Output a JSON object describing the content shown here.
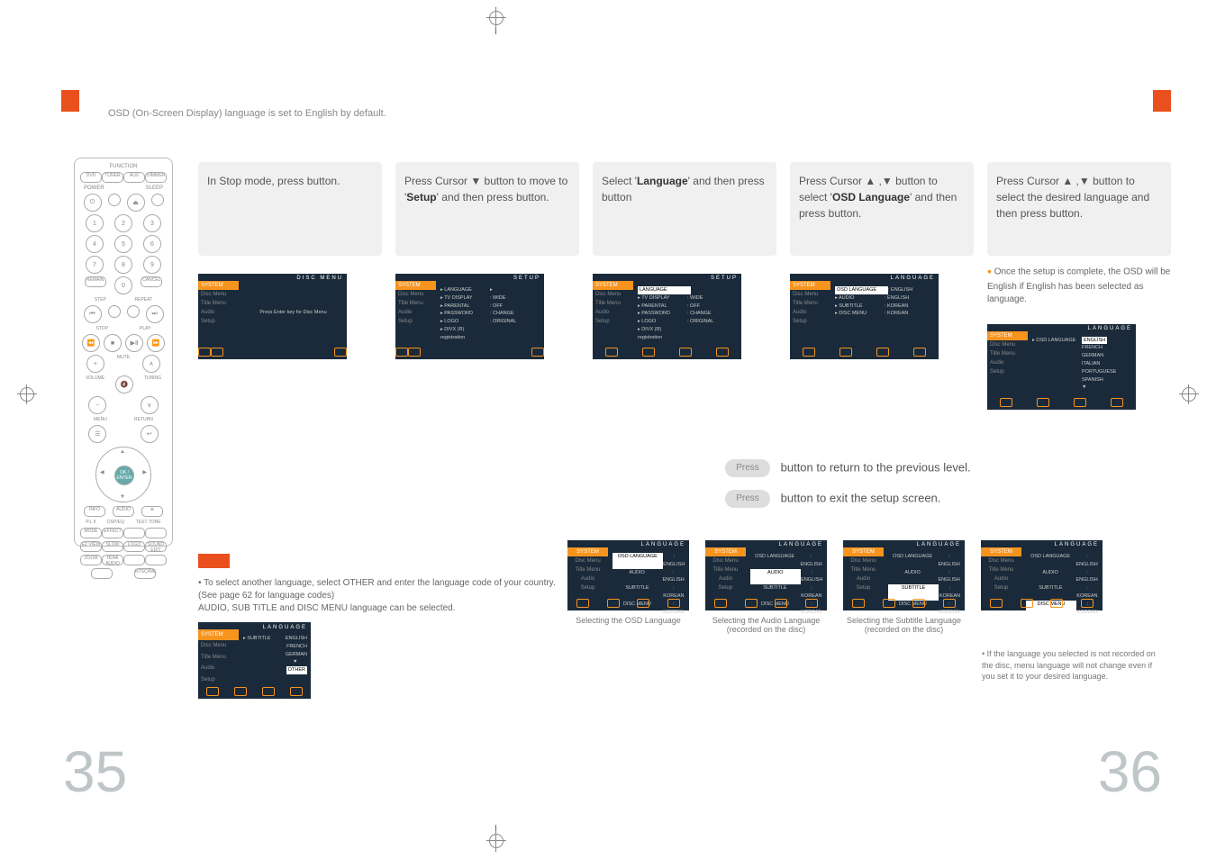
{
  "intro": "OSD (On-Screen Display) language is set to English by default.",
  "page_left": "35",
  "page_right": "36",
  "remote": {
    "func_label": "FUNCTION",
    "top_pills": [
      "DVD",
      "TUNER",
      "AUX",
      "DIMMER"
    ],
    "power": "POWER",
    "sleep": "SLEEP",
    "nums": [
      "1",
      "2",
      "3",
      "4",
      "5",
      "6",
      "7",
      "8",
      "9",
      "0"
    ],
    "remain": "REMAIN",
    "cancel": "CANCEL",
    "step": "STEP",
    "repeat": "REPEAT",
    "stop": "STOP",
    "play": "PLAY",
    "mute": "MUTE",
    "volume": "VOLUME",
    "tuning": "TUNING",
    "menu": "MENU",
    "return": "RETURN",
    "enter": "OK / ENTER",
    "info": "INFO",
    "subt": "SUB TITLE",
    "mode": "MODE",
    "dsp": "DSP/EQ",
    "test": "TEST TONE",
    "pl": "P.L II",
    "effect": "EFFECT",
    "slow": "SLOW",
    "logo": "LOGO",
    "sedit": "SOUND EDIT",
    "ezv": "EZ VIEW",
    "ntsc": "NTSC/PAL",
    "zoom": "ZOOM",
    "hdmi": "HDMI AUDIO"
  },
  "steps": [
    {
      "text_pre": "In Stop mode, press",
      "text_bold": "",
      "text_post": "button."
    },
    {
      "text_pre": "Press Cursor ▼ button to move to '",
      "text_bold": "Setup",
      "text_post": "' and then press            button."
    },
    {
      "text_pre": "Select '",
      "text_bold": "Language",
      "text_post": "' and then press            button"
    },
    {
      "text_pre": "Press Cursor ▲ ,▼ button to select '",
      "text_bold": "OSD Language",
      "text_post": "' and then press            button."
    },
    {
      "text_pre": "Press Cursor ▲ ,▼ button to select the desired language and then press            button.",
      "text_bold": "",
      "text_post": ""
    }
  ],
  "step5_note": "Once the setup is complete, the OSD will be English if English has been selected as language.",
  "osd": {
    "tabs": [
      "Disc Menu",
      "Title Menu",
      "Audio",
      "Setup"
    ],
    "header1": "DISC MENU",
    "header2": "SETUP",
    "header3": "SETUP",
    "header4": "LANGUAGE",
    "header5": "LANGUAGE",
    "body1": "Press Enter key for Disc Menu",
    "body2": [
      [
        "▸ LANGUAGE",
        "▸"
      ],
      [
        "▸ TV DISPLAY",
        ": WIDE"
      ],
      [
        "▸ PARENTAL",
        ": OFF"
      ],
      [
        "▸ PASSWORD",
        ": CHANGE"
      ],
      [
        "▸ LOGO",
        ": ORIGINAL"
      ],
      [
        "▸ DIVX (R) registration",
        ""
      ]
    ],
    "body3_top": "LANGUAGE",
    "body3": [
      [
        "▸ TV DISPLAY",
        ": WIDE"
      ],
      [
        "▸ PARENTAL",
        ": OFF"
      ],
      [
        "▸ PASSWORD",
        ": CHANGE"
      ],
      [
        "▸ LOGO",
        ": ORIGINAL"
      ],
      [
        "▸ DIVX (R) registration",
        ""
      ]
    ],
    "body4": [
      [
        "OSD LANGUAGE",
        ": ENGLISH"
      ],
      [
        "▸ AUDIO",
        ": ENGLISH"
      ],
      [
        "▸ SUBTITLE",
        ": KOREAN"
      ],
      [
        "▸ DISC MENU",
        ": KOREAN"
      ]
    ],
    "body5_left": "▸ OSD LANGUAGE",
    "body5_right": [
      "ENGLISH",
      "FRENCH",
      "GERMAN",
      "ITALIAN",
      "PORTUGUESE",
      "SPANISH",
      "▼"
    ]
  },
  "return_line": "button to return to the previous level.",
  "exit_line": "button to exit the setup screen.",
  "press": "Press",
  "other_note": "To select another language, select OTHER and enter the language code of your country. (See page 62 for language codes)\nAUDIO, SUB TITLE and DISC MENU language can be selected.",
  "small_osd": {
    "left": "▸ SUBTITLE",
    "right": [
      "ENGLISH",
      "FRENCH",
      "GERMAN",
      "▼",
      "OTHER"
    ]
  },
  "bottom_cols": [
    {
      "cap": "Selecting the OSD Language",
      "hl_row": 0,
      "rows": [
        [
          "OSD LANGUAGE",
          ": ENGLISH"
        ],
        [
          "AUDIO",
          ": ENGLISH"
        ],
        [
          "SUBTITLE",
          ": KOREAN"
        ],
        [
          "DISC MENU",
          ": KOREAN"
        ]
      ]
    },
    {
      "cap": "Selecting the Audio Language (recorded on the disc)",
      "hl_row": 1,
      "rows": [
        [
          "OSD LANGUAGE",
          ": ENGLISH"
        ],
        [
          "AUDIO",
          ": ENGLISH"
        ],
        [
          "SUBTITLE",
          ": KOREAN"
        ],
        [
          "DISC MENU",
          ": KOREAN"
        ]
      ]
    },
    {
      "cap": "Selecting the Subtitle Language (recorded on the disc)",
      "hl_row": 2,
      "rows": [
        [
          "OSD LANGUAGE",
          ": ENGLISH"
        ],
        [
          "AUDIO",
          ": ENGLISH"
        ],
        [
          "SUBTITLE",
          ": KOREAN"
        ],
        [
          "DISC MENU",
          ": KOREAN"
        ]
      ]
    },
    {
      "cap": "",
      "hl_row": 3,
      "rows": [
        [
          "OSD LANGUAGE",
          ": ENGLISH"
        ],
        [
          "AUDIO",
          ": ENGLISH"
        ],
        [
          "SUBTITLE",
          ": KOREAN"
        ],
        [
          "DISC MENU",
          ": KOREAN"
        ]
      ]
    }
  ],
  "footnote": "If the language you selected is not recorded on the disc, menu language will not change even if you set it to your desired language."
}
